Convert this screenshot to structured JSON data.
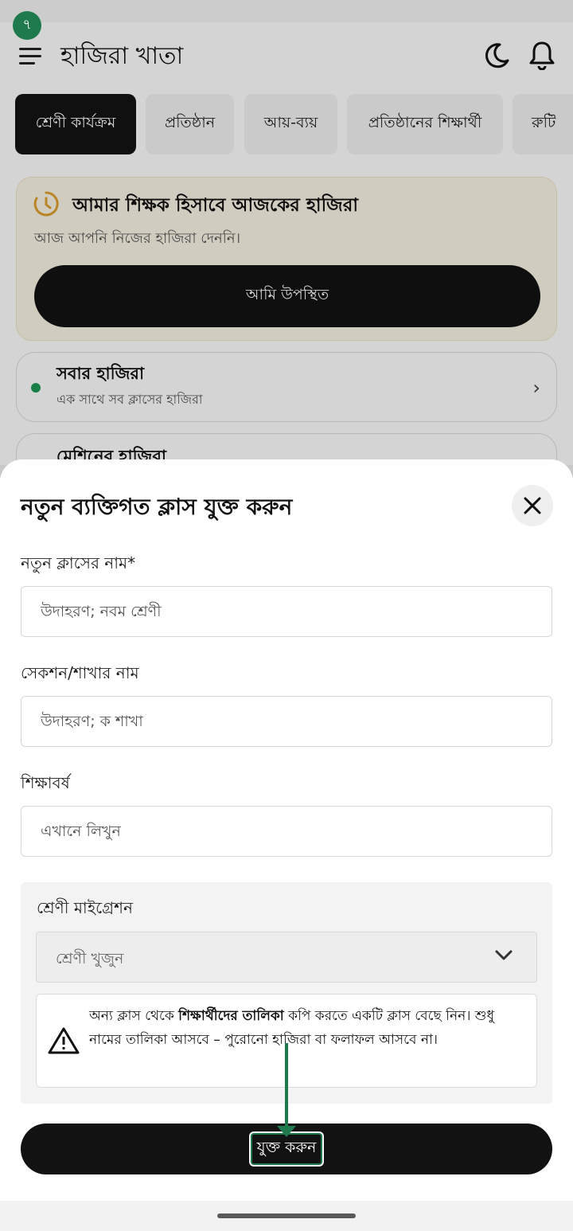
{
  "status": {
    "badge": "৭"
  },
  "appbar": {
    "title": "হাজিরা খাতা",
    "icons": [
      "menu-icon",
      "moon-icon",
      "bell-icon"
    ]
  },
  "tabs": [
    {
      "label": "শ্রেণী কার্যক্রম",
      "active": true
    },
    {
      "label": "প্রতিষ্ঠান",
      "active": false
    },
    {
      "label": "আয়-ব্যয়",
      "active": false
    },
    {
      "label": "প্রতিষ্ঠানের শিক্ষার্থী",
      "active": false
    },
    {
      "label": "রুটি",
      "active": false
    }
  ],
  "attendance_card": {
    "title": "আমার শিক্ষক হিসাবে আজকের হাজিরা",
    "subtitle": "আজ আপনি নিজের হাজিরা দেননি।",
    "button": "আমি উপস্থিত"
  },
  "rows": [
    {
      "title": "সবার হাজিরা",
      "subtitle": "এক সাথে সব ক্লাসের হাজিরা",
      "chevron": "›"
    },
    {
      "title": "মেশিনের হাজিরা"
    }
  ],
  "sheet": {
    "title": "নতুন ব্যক্তিগত ক্লাস যুক্ত করুন",
    "class_name": {
      "label": "নতুন ক্লাসের নাম*",
      "placeholder": "উদাহরণ; নবম শ্রেণী"
    },
    "section": {
      "label": "সেকশন/শাখার নাম",
      "placeholder": "উদাহরণ; ক শাখা"
    },
    "academic_year": {
      "label": "শিক্ষাবর্ষ",
      "placeholder": "এখানে লিখুন"
    },
    "migration": {
      "label": "শ্রেণী মাইগ্রেশন",
      "select_placeholder": "শ্রেণী খুজুন",
      "warning_before": "অন্য ক্লাস থেকে ",
      "warning_bold": "শিক্ষার্থীদের তালিকা",
      "warning_after": " কপি করতে একটি ক্লাস বেছে নিন। শুধু নামের তালিকা আসবে – পুরোনো হাজিরা বা ফলাফল আসবে না।"
    },
    "submit": "যুক্ত করুন"
  },
  "colors": {
    "accent": "#1e7a4c",
    "primary_button": "#131313",
    "card_bg": "#fbf6e6"
  }
}
